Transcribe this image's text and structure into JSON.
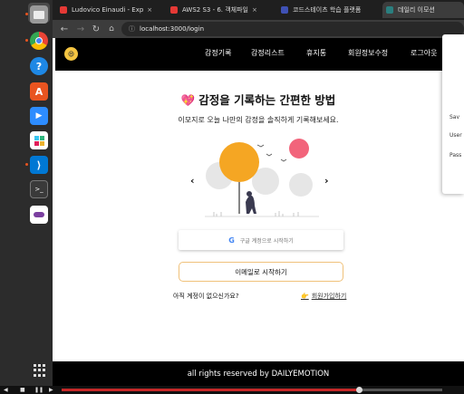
{
  "browser": {
    "tabs": [
      {
        "title": "Ludovico Einaudi - Exp",
        "favicon_color": "#e53935"
      },
      {
        "title": "AWS2 S3 - 6. 객체파일",
        "favicon_color": "#e53935"
      },
      {
        "title": "코드스테이츠 학습 플랫폼",
        "favicon_color": "#3f51b5"
      },
      {
        "title": "데일리 이모션",
        "favicon_color": "#2a7f7f"
      }
    ],
    "tab_close": "×",
    "url": "localhost:3000/login"
  },
  "nav": {
    "logo_face": "😄",
    "links": [
      "감정기록",
      "감정리스트",
      "휴지통",
      "회원정보수정",
      "로그아웃"
    ]
  },
  "hero": {
    "title": "감정을 기록하는 간편한 방법",
    "title_icon": "💖",
    "subtitle": "이모지로 오늘 나만의 감정을 솔직하게 기록해보세요."
  },
  "carousel": {
    "prev": "‹",
    "next": "›"
  },
  "auth": {
    "google_label": "구글 계정으로 시작하기",
    "google_glyph": "G",
    "email_label": "이메일로 시작하기",
    "no_account": "아직 계정이 없으신가요?",
    "signup_icon": "👉",
    "signup_link": "회원가입하기"
  },
  "footer": {
    "text": "all rights reserved by DAILYEMOTION"
  },
  "popup": {
    "title": "Sav",
    "field1": "User",
    "field2": "Pass"
  },
  "media": {
    "progress": 0.78
  },
  "colors": {
    "accent_orange": "#f5a623",
    "accent_pink": "#f2647b",
    "nav_bg": "#000000",
    "email_border": "#f0c17a"
  }
}
